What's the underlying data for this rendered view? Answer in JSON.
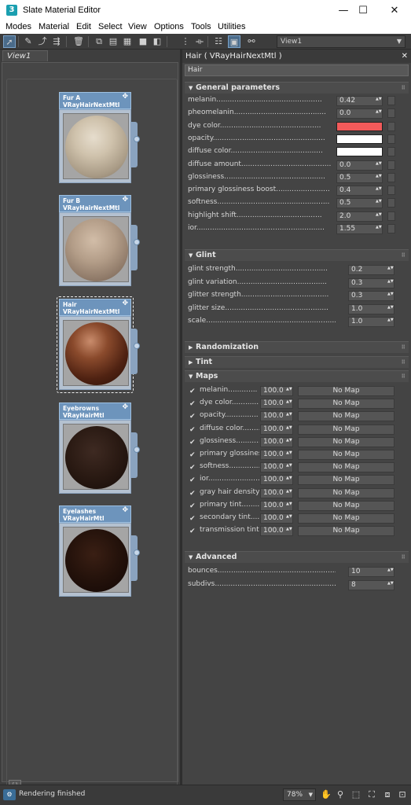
{
  "window": {
    "title": "Slate Material Editor",
    "app_icon": "3",
    "minimize": "—",
    "maximize": "☐",
    "close": "✕"
  },
  "menu": [
    "Modes",
    "Material",
    "Edit",
    "Select",
    "View",
    "Options",
    "Tools",
    "Utilities"
  ],
  "toolbar": {
    "view_selector": "View1"
  },
  "view": {
    "tab": "View1",
    "nodes": [
      {
        "name": "Fur A",
        "type": "VRayHairNextMtl",
        "selected": false,
        "swatch": "radial-gradient(circle at 45% 35%, #e6ddcd 0%, #cfc2ac 35%, #a99b86 70%, #7d7060 100%)"
      },
      {
        "name": "Fur B",
        "type": "VRayHairNextMtl",
        "selected": false,
        "swatch": "radial-gradient(circle at 45% 35%, #d2bda8 0%, #b39d88 40%, #8c7766 75%, #66554a 100%)"
      },
      {
        "name": "Hair",
        "type": "VRayHairNextMtl",
        "selected": true,
        "swatch": "radial-gradient(circle at 40% 30%, #c98c6c 0%, #8a4a2c 30%, #4f2212 65%, #2a0f06 100%)"
      },
      {
        "name": "Eyebrowns",
        "type": "VRayHairMtl",
        "selected": false,
        "swatch": "radial-gradient(circle at 45% 40%, #3e2a22 0%, #2a1a13 50%, #150b07 100%)"
      },
      {
        "name": "Eyelashes",
        "type": "VRayHairMtl",
        "selected": false,
        "swatch": "radial-gradient(circle at 45% 40%, #3a1f14 0%, #24120b 50%, #120705 100%)"
      }
    ]
  },
  "panel": {
    "header": "Hair  ( VRayHairNextMtl )",
    "material_name": "Hair",
    "general": {
      "title": "General parameters",
      "params": [
        {
          "label": "melanin...............................................",
          "value": "0.42",
          "kind": "spin"
        },
        {
          "label": "pheomelanin.........................................",
          "value": "0.0",
          "kind": "spin"
        },
        {
          "label": "dye color.............................................",
          "color": "#f25a5a",
          "kind": "color"
        },
        {
          "label": "opacity..................................................",
          "color": "#ffffff",
          "kind": "color"
        },
        {
          "label": "diffuse color.........................................",
          "color": "#ffffff",
          "kind": "color"
        },
        {
          "label": "diffuse amount........................................",
          "value": "0.0",
          "kind": "spin"
        },
        {
          "label": "glossiness.............................................",
          "value": "0.5",
          "kind": "spin"
        },
        {
          "label": "primary glossiness boost........................",
          "value": "0.4",
          "kind": "spin"
        },
        {
          "label": "softness..................................................",
          "value": "0.5",
          "kind": "spin"
        },
        {
          "label": "highlight shift......................................",
          "value": "2.0",
          "kind": "spin"
        },
        {
          "label": "ior.........................................................",
          "value": "1.55",
          "kind": "spin"
        }
      ]
    },
    "glint": {
      "title": "Glint",
      "params": [
        {
          "label": "glint strength.........................................",
          "value": "0.2"
        },
        {
          "label": "glint variation........................................",
          "value": "0.3"
        },
        {
          "label": "glitter strength.......................................",
          "value": "0.3"
        },
        {
          "label": "glitter size..............................................",
          "value": "1.0"
        },
        {
          "label": "scale...........................................................",
          "value": "1.0"
        }
      ]
    },
    "randomization": {
      "title": "Randomization"
    },
    "tint": {
      "title": "Tint"
    },
    "maps": {
      "title": "Maps",
      "check": "✔",
      "rows": [
        {
          "label": "melanin.............",
          "amount": "100.0",
          "map": "No Map"
        },
        {
          "label": "dye color............",
          "amount": "100.0",
          "map": "No Map"
        },
        {
          "label": "opacity...............",
          "amount": "100.0",
          "map": "No Map"
        },
        {
          "label": "diffuse color.........",
          "amount": "100.0",
          "map": "No Map"
        },
        {
          "label": "glossiness............",
          "amount": "100.0",
          "map": "No Map"
        },
        {
          "label": "primary glossiness",
          "amount": "100.0",
          "map": "No Map"
        },
        {
          "label": "softness...............",
          "amount": "100.0",
          "map": "No Map"
        },
        {
          "label": "ior.........................",
          "amount": "100.0",
          "map": "No Map"
        },
        {
          "label": "gray hair density..",
          "amount": "100.0",
          "map": "No Map"
        },
        {
          "label": "primary tint...........",
          "amount": "100.0",
          "map": "No Map"
        },
        {
          "label": "secondary tint.......",
          "amount": "100.0",
          "map": "No Map"
        },
        {
          "label": "transmission tint....",
          "amount": "100.0",
          "map": "No Map"
        }
      ]
    },
    "advanced": {
      "title": "Advanced",
      "params": [
        {
          "label": "bounces...........................................................",
          "value": "10"
        },
        {
          "label": "subdivs...........................................................",
          "value": "8"
        }
      ]
    }
  },
  "status": {
    "text": "Rendering finished",
    "zoom": "78%"
  }
}
